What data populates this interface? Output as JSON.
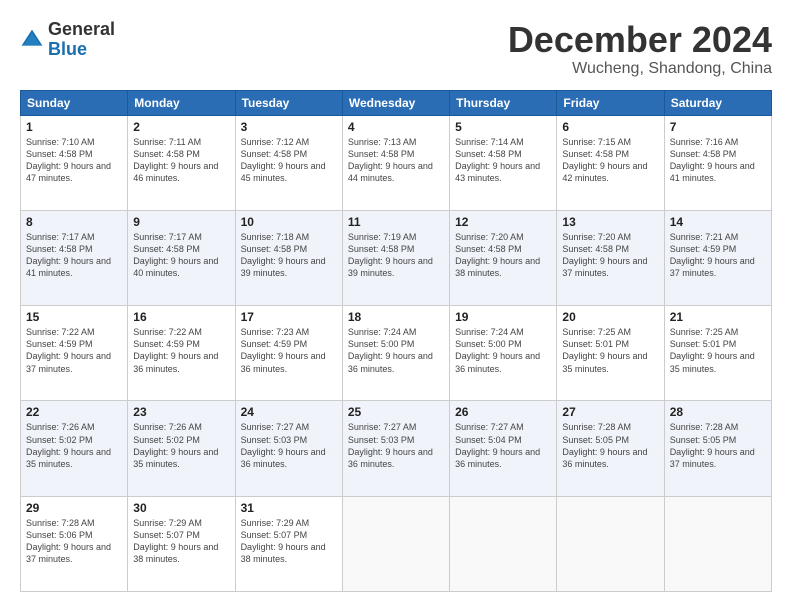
{
  "header": {
    "logo_general": "General",
    "logo_blue": "Blue",
    "month_title": "December 2024",
    "location": "Wucheng, Shandong, China"
  },
  "days_of_week": [
    "Sunday",
    "Monday",
    "Tuesday",
    "Wednesday",
    "Thursday",
    "Friday",
    "Saturday"
  ],
  "weeks": [
    [
      {
        "day": "1",
        "sunrise": "Sunrise: 7:10 AM",
        "sunset": "Sunset: 4:58 PM",
        "daylight": "Daylight: 9 hours and 47 minutes."
      },
      {
        "day": "2",
        "sunrise": "Sunrise: 7:11 AM",
        "sunset": "Sunset: 4:58 PM",
        "daylight": "Daylight: 9 hours and 46 minutes."
      },
      {
        "day": "3",
        "sunrise": "Sunrise: 7:12 AM",
        "sunset": "Sunset: 4:58 PM",
        "daylight": "Daylight: 9 hours and 45 minutes."
      },
      {
        "day": "4",
        "sunrise": "Sunrise: 7:13 AM",
        "sunset": "Sunset: 4:58 PM",
        "daylight": "Daylight: 9 hours and 44 minutes."
      },
      {
        "day": "5",
        "sunrise": "Sunrise: 7:14 AM",
        "sunset": "Sunset: 4:58 PM",
        "daylight": "Daylight: 9 hours and 43 minutes."
      },
      {
        "day": "6",
        "sunrise": "Sunrise: 7:15 AM",
        "sunset": "Sunset: 4:58 PM",
        "daylight": "Daylight: 9 hours and 42 minutes."
      },
      {
        "day": "7",
        "sunrise": "Sunrise: 7:16 AM",
        "sunset": "Sunset: 4:58 PM",
        "daylight": "Daylight: 9 hours and 41 minutes."
      }
    ],
    [
      {
        "day": "8",
        "sunrise": "Sunrise: 7:17 AM",
        "sunset": "Sunset: 4:58 PM",
        "daylight": "Daylight: 9 hours and 41 minutes."
      },
      {
        "day": "9",
        "sunrise": "Sunrise: 7:17 AM",
        "sunset": "Sunset: 4:58 PM",
        "daylight": "Daylight: 9 hours and 40 minutes."
      },
      {
        "day": "10",
        "sunrise": "Sunrise: 7:18 AM",
        "sunset": "Sunset: 4:58 PM",
        "daylight": "Daylight: 9 hours and 39 minutes."
      },
      {
        "day": "11",
        "sunrise": "Sunrise: 7:19 AM",
        "sunset": "Sunset: 4:58 PM",
        "daylight": "Daylight: 9 hours and 39 minutes."
      },
      {
        "day": "12",
        "sunrise": "Sunrise: 7:20 AM",
        "sunset": "Sunset: 4:58 PM",
        "daylight": "Daylight: 9 hours and 38 minutes."
      },
      {
        "day": "13",
        "sunrise": "Sunrise: 7:20 AM",
        "sunset": "Sunset: 4:58 PM",
        "daylight": "Daylight: 9 hours and 37 minutes."
      },
      {
        "day": "14",
        "sunrise": "Sunrise: 7:21 AM",
        "sunset": "Sunset: 4:59 PM",
        "daylight": "Daylight: 9 hours and 37 minutes."
      }
    ],
    [
      {
        "day": "15",
        "sunrise": "Sunrise: 7:22 AM",
        "sunset": "Sunset: 4:59 PM",
        "daylight": "Daylight: 9 hours and 37 minutes."
      },
      {
        "day": "16",
        "sunrise": "Sunrise: 7:22 AM",
        "sunset": "Sunset: 4:59 PM",
        "daylight": "Daylight: 9 hours and 36 minutes."
      },
      {
        "day": "17",
        "sunrise": "Sunrise: 7:23 AM",
        "sunset": "Sunset: 4:59 PM",
        "daylight": "Daylight: 9 hours and 36 minutes."
      },
      {
        "day": "18",
        "sunrise": "Sunrise: 7:24 AM",
        "sunset": "Sunset: 5:00 PM",
        "daylight": "Daylight: 9 hours and 36 minutes."
      },
      {
        "day": "19",
        "sunrise": "Sunrise: 7:24 AM",
        "sunset": "Sunset: 5:00 PM",
        "daylight": "Daylight: 9 hours and 36 minutes."
      },
      {
        "day": "20",
        "sunrise": "Sunrise: 7:25 AM",
        "sunset": "Sunset: 5:01 PM",
        "daylight": "Daylight: 9 hours and 35 minutes."
      },
      {
        "day": "21",
        "sunrise": "Sunrise: 7:25 AM",
        "sunset": "Sunset: 5:01 PM",
        "daylight": "Daylight: 9 hours and 35 minutes."
      }
    ],
    [
      {
        "day": "22",
        "sunrise": "Sunrise: 7:26 AM",
        "sunset": "Sunset: 5:02 PM",
        "daylight": "Daylight: 9 hours and 35 minutes."
      },
      {
        "day": "23",
        "sunrise": "Sunrise: 7:26 AM",
        "sunset": "Sunset: 5:02 PM",
        "daylight": "Daylight: 9 hours and 35 minutes."
      },
      {
        "day": "24",
        "sunrise": "Sunrise: 7:27 AM",
        "sunset": "Sunset: 5:03 PM",
        "daylight": "Daylight: 9 hours and 36 minutes."
      },
      {
        "day": "25",
        "sunrise": "Sunrise: 7:27 AM",
        "sunset": "Sunset: 5:03 PM",
        "daylight": "Daylight: 9 hours and 36 minutes."
      },
      {
        "day": "26",
        "sunrise": "Sunrise: 7:27 AM",
        "sunset": "Sunset: 5:04 PM",
        "daylight": "Daylight: 9 hours and 36 minutes."
      },
      {
        "day": "27",
        "sunrise": "Sunrise: 7:28 AM",
        "sunset": "Sunset: 5:05 PM",
        "daylight": "Daylight: 9 hours and 36 minutes."
      },
      {
        "day": "28",
        "sunrise": "Sunrise: 7:28 AM",
        "sunset": "Sunset: 5:05 PM",
        "daylight": "Daylight: 9 hours and 37 minutes."
      }
    ],
    [
      {
        "day": "29",
        "sunrise": "Sunrise: 7:28 AM",
        "sunset": "Sunset: 5:06 PM",
        "daylight": "Daylight: 9 hours and 37 minutes."
      },
      {
        "day": "30",
        "sunrise": "Sunrise: 7:29 AM",
        "sunset": "Sunset: 5:07 PM",
        "daylight": "Daylight: 9 hours and 38 minutes."
      },
      {
        "day": "31",
        "sunrise": "Sunrise: 7:29 AM",
        "sunset": "Sunset: 5:07 PM",
        "daylight": "Daylight: 9 hours and 38 minutes."
      },
      null,
      null,
      null,
      null
    ]
  ]
}
